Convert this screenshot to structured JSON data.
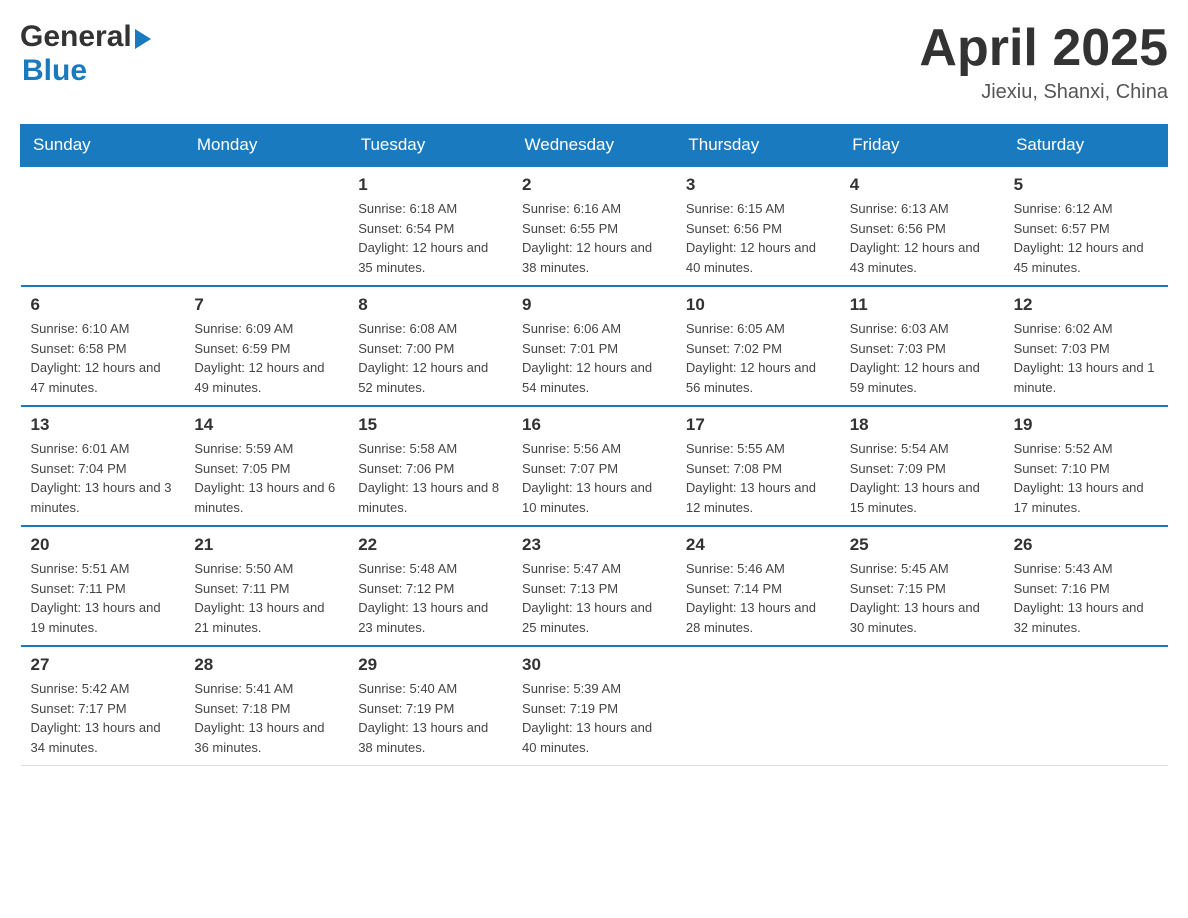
{
  "header": {
    "logo_general": "General",
    "logo_blue": "Blue",
    "title": "April 2025",
    "location": "Jiexiu, Shanxi, China"
  },
  "days_of_week": [
    "Sunday",
    "Monday",
    "Tuesday",
    "Wednesday",
    "Thursday",
    "Friday",
    "Saturday"
  ],
  "weeks": [
    [
      {
        "day": "",
        "sunrise": "",
        "sunset": "",
        "daylight": ""
      },
      {
        "day": "",
        "sunrise": "",
        "sunset": "",
        "daylight": ""
      },
      {
        "day": "1",
        "sunrise": "Sunrise: 6:18 AM",
        "sunset": "Sunset: 6:54 PM",
        "daylight": "Daylight: 12 hours and 35 minutes."
      },
      {
        "day": "2",
        "sunrise": "Sunrise: 6:16 AM",
        "sunset": "Sunset: 6:55 PM",
        "daylight": "Daylight: 12 hours and 38 minutes."
      },
      {
        "day": "3",
        "sunrise": "Sunrise: 6:15 AM",
        "sunset": "Sunset: 6:56 PM",
        "daylight": "Daylight: 12 hours and 40 minutes."
      },
      {
        "day": "4",
        "sunrise": "Sunrise: 6:13 AM",
        "sunset": "Sunset: 6:56 PM",
        "daylight": "Daylight: 12 hours and 43 minutes."
      },
      {
        "day": "5",
        "sunrise": "Sunrise: 6:12 AM",
        "sunset": "Sunset: 6:57 PM",
        "daylight": "Daylight: 12 hours and 45 minutes."
      }
    ],
    [
      {
        "day": "6",
        "sunrise": "Sunrise: 6:10 AM",
        "sunset": "Sunset: 6:58 PM",
        "daylight": "Daylight: 12 hours and 47 minutes."
      },
      {
        "day": "7",
        "sunrise": "Sunrise: 6:09 AM",
        "sunset": "Sunset: 6:59 PM",
        "daylight": "Daylight: 12 hours and 49 minutes."
      },
      {
        "day": "8",
        "sunrise": "Sunrise: 6:08 AM",
        "sunset": "Sunset: 7:00 PM",
        "daylight": "Daylight: 12 hours and 52 minutes."
      },
      {
        "day": "9",
        "sunrise": "Sunrise: 6:06 AM",
        "sunset": "Sunset: 7:01 PM",
        "daylight": "Daylight: 12 hours and 54 minutes."
      },
      {
        "day": "10",
        "sunrise": "Sunrise: 6:05 AM",
        "sunset": "Sunset: 7:02 PM",
        "daylight": "Daylight: 12 hours and 56 minutes."
      },
      {
        "day": "11",
        "sunrise": "Sunrise: 6:03 AM",
        "sunset": "Sunset: 7:03 PM",
        "daylight": "Daylight: 12 hours and 59 minutes."
      },
      {
        "day": "12",
        "sunrise": "Sunrise: 6:02 AM",
        "sunset": "Sunset: 7:03 PM",
        "daylight": "Daylight: 13 hours and 1 minute."
      }
    ],
    [
      {
        "day": "13",
        "sunrise": "Sunrise: 6:01 AM",
        "sunset": "Sunset: 7:04 PM",
        "daylight": "Daylight: 13 hours and 3 minutes."
      },
      {
        "day": "14",
        "sunrise": "Sunrise: 5:59 AM",
        "sunset": "Sunset: 7:05 PM",
        "daylight": "Daylight: 13 hours and 6 minutes."
      },
      {
        "day": "15",
        "sunrise": "Sunrise: 5:58 AM",
        "sunset": "Sunset: 7:06 PM",
        "daylight": "Daylight: 13 hours and 8 minutes."
      },
      {
        "day": "16",
        "sunrise": "Sunrise: 5:56 AM",
        "sunset": "Sunset: 7:07 PM",
        "daylight": "Daylight: 13 hours and 10 minutes."
      },
      {
        "day": "17",
        "sunrise": "Sunrise: 5:55 AM",
        "sunset": "Sunset: 7:08 PM",
        "daylight": "Daylight: 13 hours and 12 minutes."
      },
      {
        "day": "18",
        "sunrise": "Sunrise: 5:54 AM",
        "sunset": "Sunset: 7:09 PM",
        "daylight": "Daylight: 13 hours and 15 minutes."
      },
      {
        "day": "19",
        "sunrise": "Sunrise: 5:52 AM",
        "sunset": "Sunset: 7:10 PM",
        "daylight": "Daylight: 13 hours and 17 minutes."
      }
    ],
    [
      {
        "day": "20",
        "sunrise": "Sunrise: 5:51 AM",
        "sunset": "Sunset: 7:11 PM",
        "daylight": "Daylight: 13 hours and 19 minutes."
      },
      {
        "day": "21",
        "sunrise": "Sunrise: 5:50 AM",
        "sunset": "Sunset: 7:11 PM",
        "daylight": "Daylight: 13 hours and 21 minutes."
      },
      {
        "day": "22",
        "sunrise": "Sunrise: 5:48 AM",
        "sunset": "Sunset: 7:12 PM",
        "daylight": "Daylight: 13 hours and 23 minutes."
      },
      {
        "day": "23",
        "sunrise": "Sunrise: 5:47 AM",
        "sunset": "Sunset: 7:13 PM",
        "daylight": "Daylight: 13 hours and 25 minutes."
      },
      {
        "day": "24",
        "sunrise": "Sunrise: 5:46 AM",
        "sunset": "Sunset: 7:14 PM",
        "daylight": "Daylight: 13 hours and 28 minutes."
      },
      {
        "day": "25",
        "sunrise": "Sunrise: 5:45 AM",
        "sunset": "Sunset: 7:15 PM",
        "daylight": "Daylight: 13 hours and 30 minutes."
      },
      {
        "day": "26",
        "sunrise": "Sunrise: 5:43 AM",
        "sunset": "Sunset: 7:16 PM",
        "daylight": "Daylight: 13 hours and 32 minutes."
      }
    ],
    [
      {
        "day": "27",
        "sunrise": "Sunrise: 5:42 AM",
        "sunset": "Sunset: 7:17 PM",
        "daylight": "Daylight: 13 hours and 34 minutes."
      },
      {
        "day": "28",
        "sunrise": "Sunrise: 5:41 AM",
        "sunset": "Sunset: 7:18 PM",
        "daylight": "Daylight: 13 hours and 36 minutes."
      },
      {
        "day": "29",
        "sunrise": "Sunrise: 5:40 AM",
        "sunset": "Sunset: 7:19 PM",
        "daylight": "Daylight: 13 hours and 38 minutes."
      },
      {
        "day": "30",
        "sunrise": "Sunrise: 5:39 AM",
        "sunset": "Sunset: 7:19 PM",
        "daylight": "Daylight: 13 hours and 40 minutes."
      },
      {
        "day": "",
        "sunrise": "",
        "sunset": "",
        "daylight": ""
      },
      {
        "day": "",
        "sunrise": "",
        "sunset": "",
        "daylight": ""
      },
      {
        "day": "",
        "sunrise": "",
        "sunset": "",
        "daylight": ""
      }
    ]
  ]
}
